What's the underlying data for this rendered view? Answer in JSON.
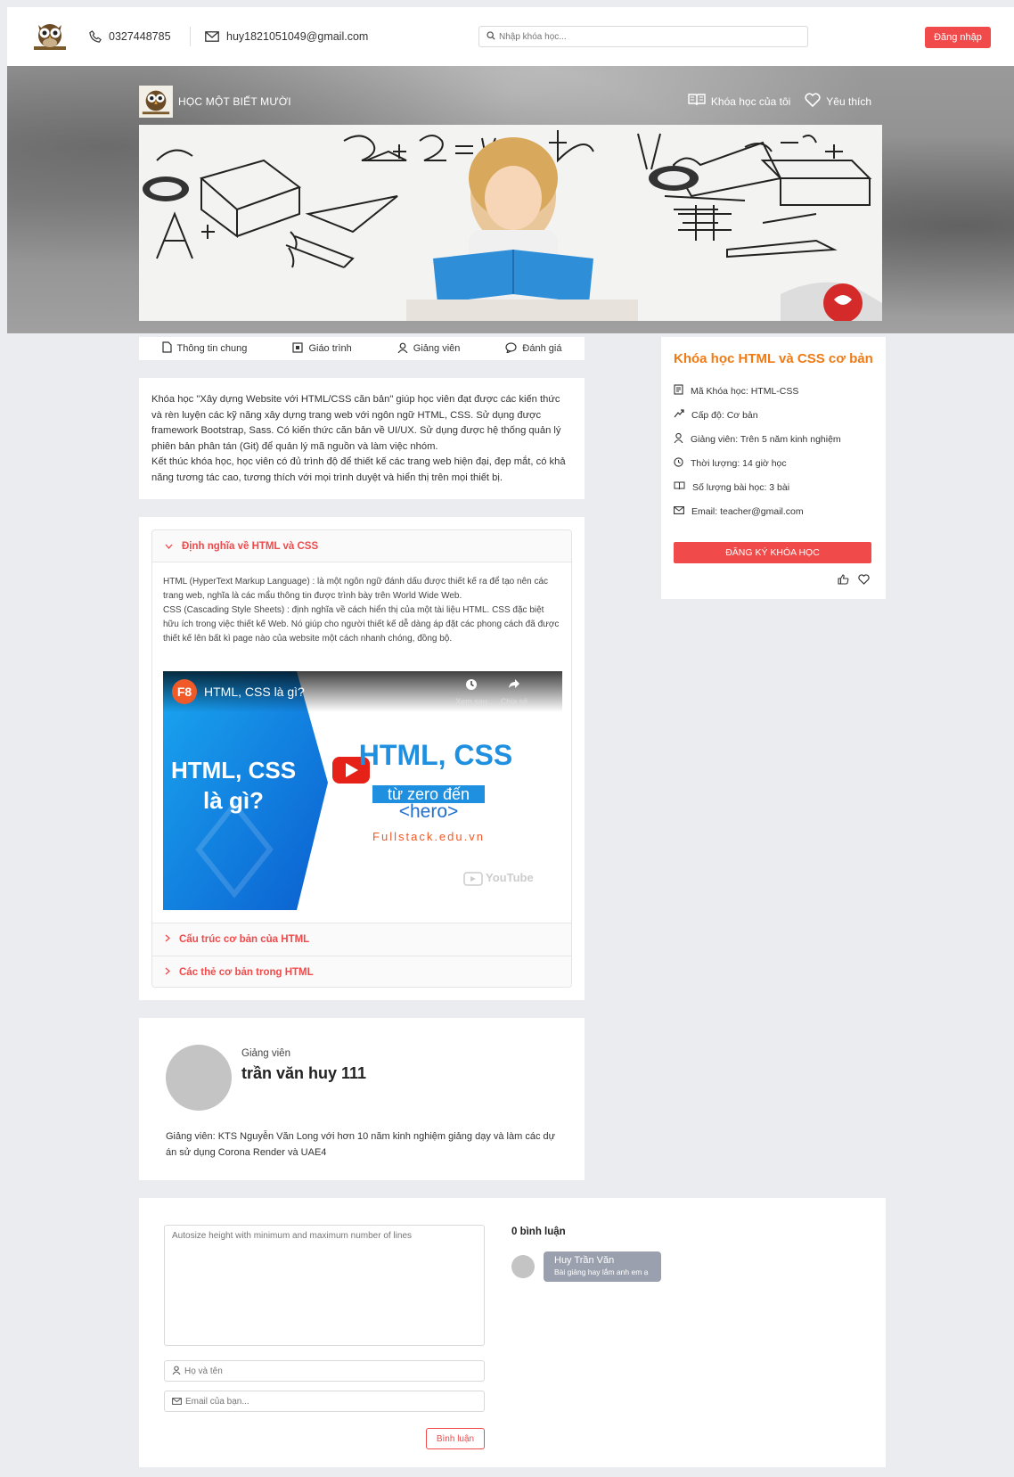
{
  "topbar": {
    "phone": "0327448785",
    "email": "huy1821051049@gmail.com",
    "search_placeholder": "Nhập khóa học...",
    "login_label": "Đăng nhập"
  },
  "hero": {
    "brand": "HỌC MỘT BIẾT MƯỜI",
    "my_courses": "Khóa học của tôi",
    "favorites": "Yêu thích"
  },
  "tabs": [
    {
      "label": "Thông tin chung",
      "icon": "document-icon"
    },
    {
      "label": "Giáo trình",
      "icon": "book-icon"
    },
    {
      "label": "Giảng viên",
      "icon": "user-icon"
    },
    {
      "label": "Đánh giá",
      "icon": "chat-icon"
    }
  ],
  "description": {
    "p1": "Khóa học \"Xây dựng Website với HTML/CSS căn bản\" giúp học viên đạt được các kiến thức và rèn luyện các kỹ năng xây dựng trang web với ngôn ngữ HTML, CSS. Sử dụng được framework Bootstrap, Sass. Có kiến thức căn bản về UI/UX. Sử dụng được hệ thống quản lý phiên bản phân tán (Git) để quản lý mã nguồn và làm việc nhóm.",
    "p2": "Kết thúc khóa học, học viên có đủ trình độ để thiết kế các trang web hiện đại, đẹp mắt, có khả năng tương tác cao, tương thích với mọi trình duyệt và hiển thị trên mọi thiết bị."
  },
  "syllabus": {
    "open_title": "Định nghĩa về HTML và CSS",
    "body1": "HTML (HyperText Markup Language) : là một ngôn ngữ đánh dấu được thiết kế ra để tạo nên các trang web, nghĩa là các mẩu thông tin được trình bày trên World Wide Web.",
    "body2": "CSS (Cascading Style Sheets) : định nghĩa về cách hiển thị của một tài liệu HTML. CSS đặc biệt hữu ích trong việc thiết kế Web. Nó giúp cho người thiết kế dễ dàng áp đặt các phong cách đã được thiết kế lên bất kì page nào của website một cách nhanh chóng, đồng bộ.",
    "video": {
      "channel": "F8",
      "title": "HTML, CSS là gì?",
      "left_text_1": "HTML, CSS",
      "left_text_2": "là gì?",
      "right_title": "HTML, CSS",
      "right_sub": "từ zero đến",
      "right_hero": "<hero>",
      "site": "Fullstack.edu.vn",
      "watch_later": "Xem sau",
      "share": "Chia sẻ",
      "youtube": "YouTube"
    },
    "items": [
      "Cấu trúc cơ bản của HTML",
      "Các thẻ cơ bản trong HTML"
    ]
  },
  "teacher": {
    "role": "Giảng viên",
    "name": "trần văn huy 111",
    "bio": "Giảng viên: KTS Nguyễn Văn Long với hơn 10 năm kinh nghiệm giảng dạy và làm các dự án sử dụng Corona Render và UAE4"
  },
  "course": {
    "title": "Khóa học HTML và CSS cơ bản",
    "rows": [
      {
        "icon": "code-icon",
        "text": "Mã Khóa học: HTML-CSS"
      },
      {
        "icon": "trend-icon",
        "text": "Cấp độ: Cơ bản"
      },
      {
        "icon": "user-icon",
        "text": "Giảng viên: Trên 5 năm kinh nghiệm"
      },
      {
        "icon": "clock-icon",
        "text": "Thời lượng: 14 giờ học"
      },
      {
        "icon": "book-icon",
        "text": "Số lượng bài học: 3 bài"
      },
      {
        "icon": "mail-icon",
        "text": "Email: teacher@gmail.com"
      }
    ],
    "register_label": "ĐĂNG KÝ KHÓA HỌC"
  },
  "comments": {
    "textarea_placeholder": "Autosize height with minimum and maximum number of lines",
    "name_placeholder": "Họ và tên",
    "email_placeholder": "Email của bạn...",
    "submit_label": "Bình luận",
    "count_label": "0 bình luận",
    "list": [
      {
        "name": "Huy Trần Văn",
        "text": "Bài giảng hay lắm anh em ạ"
      }
    ]
  },
  "colors": {
    "accent": "#f04a4a",
    "title_orange": "#f07a14",
    "bg": "#ebecf0"
  }
}
